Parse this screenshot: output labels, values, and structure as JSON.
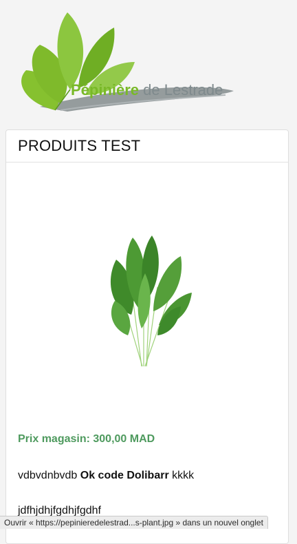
{
  "brand": {
    "name_part1": "Pépinière",
    "name_part2": "de Lestrade",
    "green": "#79b928",
    "gray": "#7f8a8d"
  },
  "product": {
    "title": "PRODUITS TEST",
    "image_icon": "arugula-leaves-image",
    "price_text": "Prix magasin: 300,00 MAD",
    "description_prefix": "vdbvdnbvdb",
    "description_bold": "Ok code Dolibarr",
    "description_suffix": "kkkk",
    "description_line2": "jdfhjdhjfgdhjfgdhf"
  },
  "status_bar": {
    "text": "Ouvrir « https://pepinieredelestrad...s-plant.jpg » dans un nouvel onglet"
  },
  "colors": {
    "price_green": "#4e9a5e",
    "background": "#f4f4f4"
  }
}
